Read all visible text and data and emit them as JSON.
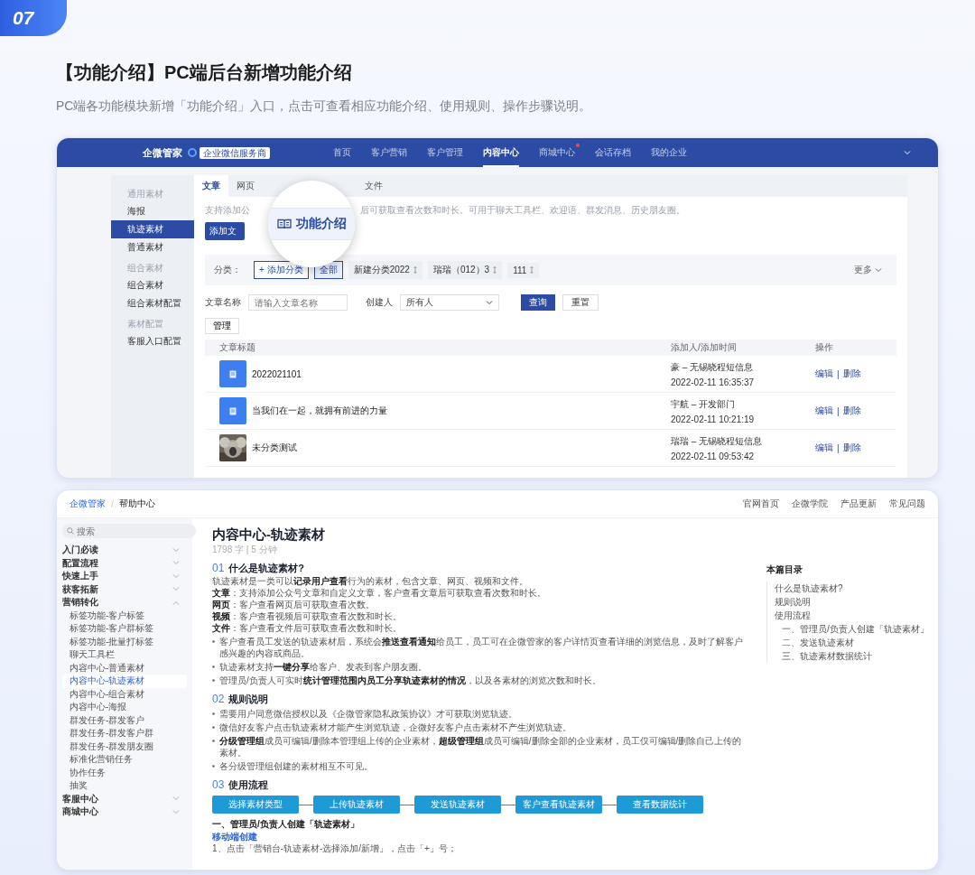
{
  "badge": "07",
  "title": "【功能介绍】PC端后台新增功能介绍",
  "subtitle": "PC端各功能模块新增「功能介绍」入口，点击可查看相应功能介绍、使用规则、操作步骤说明。",
  "admin_screenshot": {
    "brand": "企微管家",
    "partner_badge": "企业微信服务商",
    "nav": [
      {
        "label": "首页",
        "selected": false,
        "dot": false
      },
      {
        "label": "客户营销",
        "selected": false,
        "dot": false
      },
      {
        "label": "客户管理",
        "selected": false,
        "dot": false
      },
      {
        "label": "内容中心",
        "selected": true,
        "dot": false
      },
      {
        "label": "商城中心",
        "selected": false,
        "dot": true
      },
      {
        "label": "会话存档",
        "selected": false,
        "dot": false
      },
      {
        "label": "我的企业",
        "selected": false,
        "dot": false
      }
    ],
    "sidebar": [
      {
        "kind": "group",
        "label": "通用素材"
      },
      {
        "kind": "item",
        "label": "海报",
        "selected": false
      },
      {
        "kind": "item",
        "label": "轨迹素材",
        "selected": true
      },
      {
        "kind": "item",
        "label": "普通素材",
        "selected": false
      },
      {
        "kind": "group",
        "label": "组合素材"
      },
      {
        "kind": "item",
        "label": "组合素材",
        "selected": false
      },
      {
        "kind": "item",
        "label": "组合素材配置",
        "selected": false
      },
      {
        "kind": "group",
        "label": "素材配置"
      },
      {
        "kind": "item",
        "label": "客服入口配置",
        "selected": false
      }
    ],
    "tabs": [
      {
        "label": "文章",
        "selected": true
      },
      {
        "label": "网页",
        "selected": false
      },
      {
        "label": "文件",
        "selected": false
      }
    ],
    "description_start": "支持添加公",
    "description_end": "后可获取查看次数和时长。可用于聊天工具栏、欢迎语、群发消息、历史朋友圈。",
    "add_button": "添加文",
    "feature_intro": "功能介绍",
    "filter": {
      "label": "分类：",
      "add": "+ 添加分类",
      "options": [
        {
          "label": "全部",
          "selected": true
        },
        {
          "label": "新建分类2022",
          "selected": false
        },
        {
          "label": "瑞瑞（012）3",
          "selected": false
        },
        {
          "label": "111",
          "selected": false
        }
      ],
      "more": "更多"
    },
    "search": {
      "name_label": "文章名称",
      "name_placeholder": "请输入文章名称",
      "creator_label": "创建人",
      "creator_value": "所有人",
      "query": "查询",
      "reset": "重置"
    },
    "manage": "管理",
    "table": {
      "columns": [
        "文章标题",
        "添加人/添加时间",
        "操作"
      ],
      "rows": [
        {
          "kind": "document",
          "title": "2022021101",
          "adder": "豪 – 无锡晓程短信息",
          "time": "2022-02-11 16:35:37",
          "edit": "编辑",
          "separator": "|",
          "delete": "删除"
        },
        {
          "kind": "document",
          "title": "当我们在一起，就拥有前进的力量",
          "adder": "宇航 – 开发部门",
          "time": "2022-02-11 10:21:19",
          "edit": "编辑",
          "separator": "|",
          "delete": "删除"
        },
        {
          "kind": "picture",
          "title": "未分类测试",
          "adder": "瑞瑞 – 无锡晓程短信息",
          "time": "2022-02-11 09:53:42",
          "edit": "编辑",
          "separator": "|",
          "delete": "删除"
        }
      ]
    }
  },
  "help_screenshot": {
    "breadcrumb": {
      "home": "企微管家",
      "separator": "/",
      "current": "帮助中心"
    },
    "top_links": [
      "官网首页",
      "企微学院",
      "产品更新",
      "常见问题"
    ],
    "search_placeholder": "搜索",
    "nav": [
      {
        "label": "入门必读",
        "expanded": false
      },
      {
        "label": "配置流程",
        "expanded": false
      },
      {
        "label": "快速上手",
        "expanded": false
      },
      {
        "label": "获客拓新",
        "expanded": false
      },
      {
        "label": "营销转化",
        "expanded": true,
        "children": [
          {
            "label": "标签功能-客户标签",
            "selected": false
          },
          {
            "label": "标签功能-客户群标签",
            "selected": false
          },
          {
            "label": "标签功能-批量打标签",
            "selected": false
          },
          {
            "label": "聊天工具栏",
            "selected": false
          },
          {
            "label": "内容中心-普通素材",
            "selected": false
          },
          {
            "label": "内容中心-轨迹素材",
            "selected": true
          },
          {
            "label": "内容中心-组合素材",
            "selected": false
          },
          {
            "label": "内容中心-海报",
            "selected": false
          },
          {
            "label": "群发任务-群发客户",
            "selected": false
          },
          {
            "label": "群发任务-群发客户群",
            "selected": false
          },
          {
            "label": "群发任务-群发朋友圈",
            "selected": false
          },
          {
            "label": "标准化营销任务",
            "selected": false
          },
          {
            "label": "协作任务",
            "selected": false
          },
          {
            "label": "抽奖",
            "selected": false
          }
        ]
      },
      {
        "label": "客服中心",
        "expanded": false
      },
      {
        "label": "商城中心",
        "expanded": false
      }
    ],
    "doc": {
      "title": "内容中心-轨迹素材",
      "meta": "1798 字 | 5 分钟",
      "sections": [
        {
          "number": "01",
          "heading": "什么是轨迹素材?",
          "blocks": [
            {
              "kind": "paragraph",
              "text": "轨迹素材是一类可以**记录用户查看**行为的素材，包含文章、网页、视频和文件。"
            },
            {
              "kind": "paragraph",
              "text": "**文章**：支持添加公众号文章和自定义文章，客户查看文章后可获取查看次数和时长。"
            },
            {
              "kind": "paragraph",
              "text": "**网页**：客户查看网页后可获取查看次数。"
            },
            {
              "kind": "paragraph",
              "text": "**视频**：客户查看视频后可获取查看次数和时长。"
            },
            {
              "kind": "paragraph",
              "text": "**文件**：客户查看文件后可获取查看次数和时长。"
            },
            {
              "kind": "bullet",
              "text": "客户查看员工发送的轨迹素材后，系统会**推送查看通知**给员工，员工可在企微管家的客户详情页查看详细的浏览信息，及时了解客户感兴趣的内容或商品。"
            },
            {
              "kind": "bullet",
              "text": "轨迹素材支持**一键分享**给客户、发表到客户朋友圈。"
            },
            {
              "kind": "bullet",
              "text": "管理员/负责人可实时**统计管理范围内员工分享轨迹素材的情况**，以及各素材的浏览次数和时长。"
            }
          ]
        },
        {
          "number": "02",
          "heading": "规则说明",
          "blocks": [
            {
              "kind": "bullet",
              "text": "需要用户同意微信授权以及《企微管家隐私政策协议》才可获取浏览轨迹。"
            },
            {
              "kind": "bullet",
              "text": "微信好友客户点击轨迹素材才能产生浏览轨迹，企微好友客户点击素材不产生浏览轨迹。"
            },
            {
              "kind": "bullet",
              "text": "**分级管理组**成员可编辑/删除本管理组上传的企业素材，**超级管理组**成员可编辑/删除全部的企业素材，员工仅可编辑/删除自己上传的素材。"
            },
            {
              "kind": "bullet",
              "text": "各分级管理组创建的素材相互不可见。"
            }
          ]
        },
        {
          "number": "03",
          "heading": "使用流程",
          "blocks": [
            {
              "kind": "flow",
              "steps": [
                "选择素材类型",
                "上传轨迹素材",
                "发送轨迹素材",
                "客户查看轨迹素材",
                "查看数据统计"
              ]
            },
            {
              "kind": "subheading",
              "text": "一、管理员/负责人创建「轨迹素材」"
            },
            {
              "kind": "label",
              "text": "移动端创建"
            },
            {
              "kind": "paragraph",
              "text": "1、点击「营销台-轨迹素材-选择添加/新增」，点击「+」号；"
            }
          ]
        }
      ]
    },
    "toc": {
      "title": "本篇目录",
      "items": [
        {
          "label": "什么是轨迹素材?"
        },
        {
          "label": "规则说明"
        },
        {
          "label": "使用流程",
          "children": [
            {
              "label": "一、管理员/负责人创建「轨迹素材」"
            },
            {
              "label": "二、发送轨迹素材"
            },
            {
              "label": "三、轨迹素材数据统计"
            }
          ]
        }
      ]
    }
  }
}
